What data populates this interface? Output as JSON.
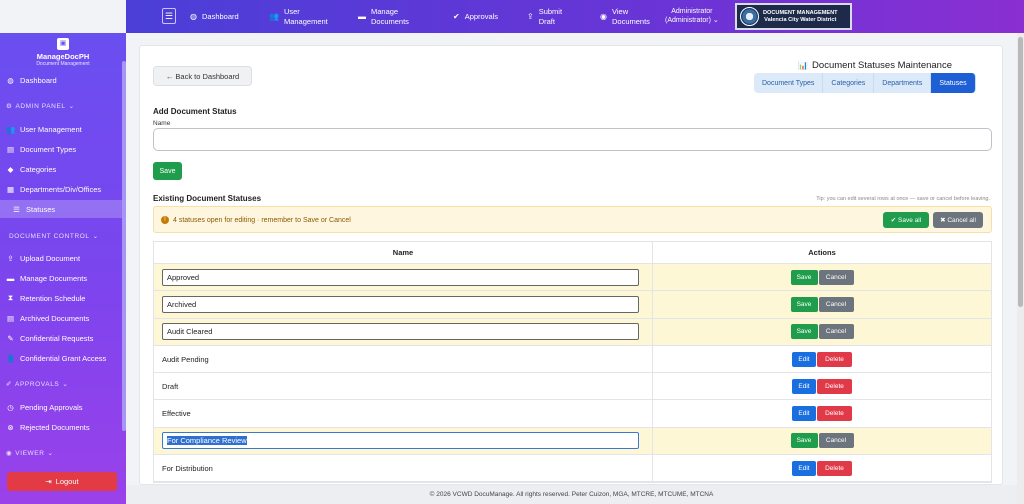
{
  "topnav": {
    "items": [
      {
        "icon": "dashboard-icon",
        "glyph": "◍",
        "label": "Dashboard"
      },
      {
        "icon": "users-icon",
        "glyph": "👥",
        "label": "User\nManagement"
      },
      {
        "icon": "folder-icon",
        "glyph": "▬",
        "label": "Manage\nDocuments"
      },
      {
        "icon": "check-circle-icon",
        "glyph": "✔",
        "label": "Approvals"
      },
      {
        "icon": "upload-icon",
        "glyph": "⇪",
        "label": "Submit\nDraft"
      },
      {
        "icon": "eye-icon",
        "glyph": "◉",
        "label": "View\nDocuments"
      }
    ],
    "admin_name": "Administrator",
    "admin_role": "(Administrator)",
    "brand_line1": "DOCUMENT MANAGEMENT",
    "brand_line2": "Valencia City Water District"
  },
  "sidebar": {
    "app_name": "ManageDocPH",
    "app_sub": "Document Management",
    "dashboard": "Dashboard",
    "admin_panel": "ADMIN PANEL",
    "admin_items": [
      "User Management",
      "Document Types",
      "Categories",
      "Departments/Div/Offices",
      "Statuses"
    ],
    "doc_control": "DOCUMENT CONTROL",
    "doc_items": [
      "Upload Document",
      "Manage Documents",
      "Retention Schedule",
      "Archived Documents",
      "Confidential Requests",
      "Confidential Grant Access"
    ],
    "approvals": "APPROVALS",
    "approval_items": [
      "Pending Approvals",
      "Rejected Documents"
    ],
    "viewer": "VIEWER",
    "logout": "Logout"
  },
  "main": {
    "back_label": "← Back to Dashboard",
    "title": "Document Statuses Maintenance",
    "tabs": [
      "Document Types",
      "Categories",
      "Departments",
      "Statuses"
    ],
    "add_title": "Add Document Status",
    "name_label": "Name",
    "name_value": "",
    "save_label": "Save",
    "existing_title": "Existing Document Statuses",
    "tip": "Tip: you can edit several rows at once — save or cancel before leaving.",
    "alert_text": "4 statuses open for editing · remember to Save or Cancel",
    "save_all": "✔ Save all",
    "cancel_all": "✖ Cancel all",
    "col_name": "Name",
    "col_actions": "Actions",
    "rows": [
      {
        "name": "Approved",
        "editing": true
      },
      {
        "name": "Archived",
        "editing": true
      },
      {
        "name": "Audit Cleared",
        "editing": true
      },
      {
        "name": "Audit Pending",
        "editing": false
      },
      {
        "name": "Draft",
        "editing": false
      },
      {
        "name": "Effective",
        "editing": false
      },
      {
        "name": "For Compliance Review",
        "editing": true,
        "focused": true
      },
      {
        "name": "For Distribution",
        "editing": false
      }
    ],
    "btn_save": "Save",
    "btn_cancel": "Cancel",
    "btn_edit": "Edit",
    "btn_delete": "Delete"
  },
  "footer": "© 2026 VCWD DocuManage. All rights reserved. Peter Cuizon, MGA, MTCRE, MTCUME, MTCNA"
}
